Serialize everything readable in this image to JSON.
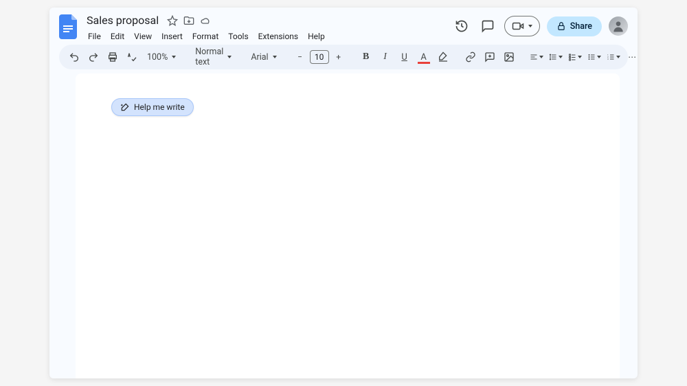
{
  "header": {
    "doc_title": "Sales proposal",
    "menus": [
      "File",
      "Edit",
      "View",
      "Insert",
      "Format",
      "Tools",
      "Extensions",
      "Help"
    ],
    "share_label": "Share"
  },
  "toolbar": {
    "zoom": "100%",
    "style": "Normal text",
    "font": "Arial",
    "font_size": "10"
  },
  "document": {
    "help_write_label": "Help me write"
  }
}
